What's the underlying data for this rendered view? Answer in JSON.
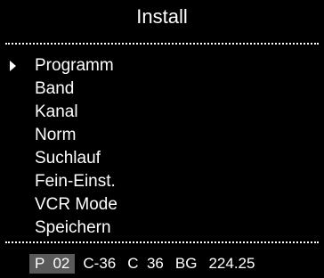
{
  "screen": {
    "title": "Install"
  },
  "menu": {
    "selected_index": 0,
    "items": [
      {
        "label": "Programm"
      },
      {
        "label": "Band"
      },
      {
        "label": "Kanal"
      },
      {
        "label": "Norm"
      },
      {
        "label": "Suchlauf"
      },
      {
        "label": "Fein-Einst."
      },
      {
        "label": "VCR Mode"
      },
      {
        "label": "Speichern"
      }
    ]
  },
  "status": {
    "program": "P  02",
    "channel_code": "C-36",
    "channel": "C  36",
    "norm": "BG",
    "frequency": "224.25"
  },
  "colors": {
    "background": "#000000",
    "text": "#ffffff",
    "highlight": "#595959"
  }
}
